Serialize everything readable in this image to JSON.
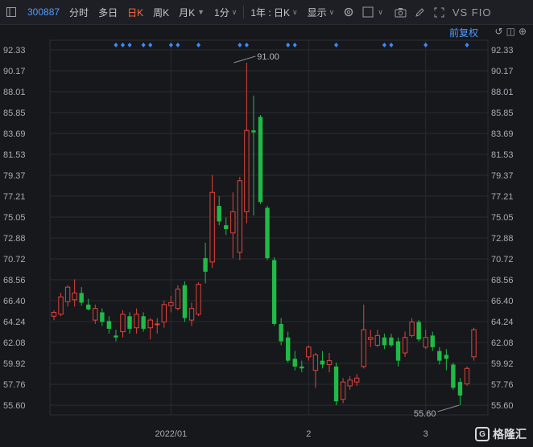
{
  "toolbar": {
    "code": "300887",
    "items": [
      "分时",
      "多日",
      "日K",
      "周K",
      "月K",
      "1分",
      "1年 : 日K",
      "显示"
    ],
    "vs": "VS FIO"
  },
  "fuquan": "前复权",
  "watermark": "格隆汇",
  "colors": {
    "up": "#e0433a",
    "down": "#1fbb46",
    "background": "#17181c",
    "marker": "#3d8bff"
  },
  "chart_data": {
    "type": "candlestick",
    "ylim": [
      55.6,
      92.33
    ],
    "y_ticks": [
      "92.33",
      "90.17",
      "88.01",
      "85.85",
      "83.69",
      "81.53",
      "79.37",
      "77.21",
      "75.05",
      "72.88",
      "70.72",
      "68.56",
      "66.40",
      "64.24",
      "62.08",
      "59.92",
      "57.76",
      "55.60"
    ],
    "x_labels": [
      {
        "label": "2022/01",
        "index": 17
      },
      {
        "label": "2",
        "index": 37
      },
      {
        "label": "3",
        "index": 54
      }
    ],
    "annotations": [
      {
        "text": "91.00",
        "index": 26,
        "value": 91.0
      },
      {
        "text": "55.60",
        "index": 59,
        "value": 55.6
      }
    ],
    "event_marker_indices": [
      9,
      10,
      11,
      13,
      14,
      17,
      18,
      21,
      27,
      28,
      34,
      35,
      41,
      48,
      49,
      54,
      60
    ],
    "candles": [
      {
        "o": 64.8,
        "h": 65.4,
        "l": 64.4,
        "c": 65.2
      },
      {
        "o": 65.0,
        "h": 67.2,
        "l": 64.8,
        "c": 66.8
      },
      {
        "o": 66.3,
        "h": 68.0,
        "l": 65.8,
        "c": 67.8
      },
      {
        "o": 66.5,
        "h": 68.6,
        "l": 65.8,
        "c": 67.2
      },
      {
        "o": 67.2,
        "h": 67.8,
        "l": 65.9,
        "c": 66.2
      },
      {
        "o": 66.0,
        "h": 66.6,
        "l": 65.4,
        "c": 65.5
      },
      {
        "o": 64.4,
        "h": 66.0,
        "l": 64.0,
        "c": 65.6
      },
      {
        "o": 65.2,
        "h": 65.6,
        "l": 63.8,
        "c": 64.2
      },
      {
        "o": 64.3,
        "h": 64.8,
        "l": 63.0,
        "c": 63.5
      },
      {
        "o": 62.8,
        "h": 63.4,
        "l": 62.2,
        "c": 62.6
      },
      {
        "o": 63.2,
        "h": 65.4,
        "l": 62.6,
        "c": 65.0
      },
      {
        "o": 64.8,
        "h": 65.2,
        "l": 63.0,
        "c": 63.5
      },
      {
        "o": 63.6,
        "h": 65.6,
        "l": 63.0,
        "c": 65.0
      },
      {
        "o": 64.8,
        "h": 65.2,
        "l": 63.2,
        "c": 63.5
      },
      {
        "o": 63.6,
        "h": 64.6,
        "l": 62.4,
        "c": 64.4
      },
      {
        "o": 64.0,
        "h": 64.6,
        "l": 63.0,
        "c": 64.0
      },
      {
        "o": 64.2,
        "h": 66.4,
        "l": 63.6,
        "c": 66.0
      },
      {
        "o": 65.9,
        "h": 66.9,
        "l": 65.2,
        "c": 66.2
      },
      {
        "o": 65.6,
        "h": 68.0,
        "l": 65.4,
        "c": 67.6
      },
      {
        "o": 68.0,
        "h": 68.4,
        "l": 64.2,
        "c": 64.6
      },
      {
        "o": 64.4,
        "h": 66.2,
        "l": 63.8,
        "c": 65.6
      },
      {
        "o": 65.0,
        "h": 68.3,
        "l": 64.8,
        "c": 68.1
      },
      {
        "o": 70.8,
        "h": 72.4,
        "l": 68.2,
        "c": 69.4
      },
      {
        "o": 70.4,
        "h": 79.4,
        "l": 69.8,
        "c": 77.6
      },
      {
        "o": 76.2,
        "h": 77.2,
        "l": 74.2,
        "c": 74.6
      },
      {
        "o": 74.2,
        "h": 75.0,
        "l": 73.2,
        "c": 73.8
      },
      {
        "o": 73.4,
        "h": 77.6,
        "l": 70.8,
        "c": 75.6
      },
      {
        "o": 71.4,
        "h": 79.2,
        "l": 70.6,
        "c": 78.8
      },
      {
        "o": 75.6,
        "h": 91.0,
        "l": 74.4,
        "c": 84.0
      },
      {
        "o": 84.0,
        "h": 87.6,
        "l": 75.2,
        "c": 83.8
      },
      {
        "o": 85.4,
        "h": 85.6,
        "l": 76.4,
        "c": 76.6
      },
      {
        "o": 76.0,
        "h": 76.2,
        "l": 70.6,
        "c": 70.8
      },
      {
        "o": 70.6,
        "h": 70.9,
        "l": 63.8,
        "c": 64.0
      },
      {
        "o": 64.0,
        "h": 64.6,
        "l": 61.8,
        "c": 62.2
      },
      {
        "o": 62.6,
        "h": 63.2,
        "l": 60.0,
        "c": 60.2
      },
      {
        "o": 60.4,
        "h": 61.2,
        "l": 59.2,
        "c": 59.6
      },
      {
        "o": 59.6,
        "h": 60.2,
        "l": 59.0,
        "c": 59.4
      },
      {
        "o": 60.6,
        "h": 61.8,
        "l": 60.2,
        "c": 61.6
      },
      {
        "o": 59.2,
        "h": 61.0,
        "l": 57.4,
        "c": 60.8
      },
      {
        "o": 60.2,
        "h": 61.2,
        "l": 59.4,
        "c": 59.8
      },
      {
        "o": 59.8,
        "h": 61.0,
        "l": 59.0,
        "c": 60.2
      },
      {
        "o": 59.6,
        "h": 60.0,
        "l": 55.6,
        "c": 56.0
      },
      {
        "o": 56.2,
        "h": 58.4,
        "l": 55.8,
        "c": 58.0
      },
      {
        "o": 57.6,
        "h": 58.6,
        "l": 57.2,
        "c": 58.2
      },
      {
        "o": 58.0,
        "h": 58.8,
        "l": 57.6,
        "c": 58.4
      },
      {
        "o": 59.6,
        "h": 66.0,
        "l": 59.4,
        "c": 63.4
      },
      {
        "o": 62.4,
        "h": 63.4,
        "l": 61.6,
        "c": 62.6
      },
      {
        "o": 61.8,
        "h": 63.4,
        "l": 61.6,
        "c": 62.8
      },
      {
        "o": 62.6,
        "h": 63.0,
        "l": 61.4,
        "c": 61.8
      },
      {
        "o": 62.6,
        "h": 63.0,
        "l": 61.6,
        "c": 61.8
      },
      {
        "o": 62.2,
        "h": 62.6,
        "l": 59.6,
        "c": 60.2
      },
      {
        "o": 61.0,
        "h": 63.2,
        "l": 60.6,
        "c": 62.6
      },
      {
        "o": 62.8,
        "h": 64.6,
        "l": 62.6,
        "c": 64.2
      },
      {
        "o": 64.2,
        "h": 64.4,
        "l": 62.2,
        "c": 62.4
      },
      {
        "o": 61.6,
        "h": 63.4,
        "l": 61.4,
        "c": 62.6
      },
      {
        "o": 62.8,
        "h": 63.2,
        "l": 61.2,
        "c": 61.6
      },
      {
        "o": 61.2,
        "h": 61.6,
        "l": 59.8,
        "c": 60.2
      },
      {
        "o": 60.8,
        "h": 61.4,
        "l": 59.2,
        "c": 60.4
      },
      {
        "o": 59.8,
        "h": 60.0,
        "l": 57.2,
        "c": 57.4
      },
      {
        "o": 58.0,
        "h": 58.4,
        "l": 55.6,
        "c": 56.6
      },
      {
        "o": 57.8,
        "h": 59.6,
        "l": 57.6,
        "c": 59.4
      },
      {
        "o": 60.6,
        "h": 63.6,
        "l": 60.2,
        "c": 63.4
      }
    ]
  }
}
